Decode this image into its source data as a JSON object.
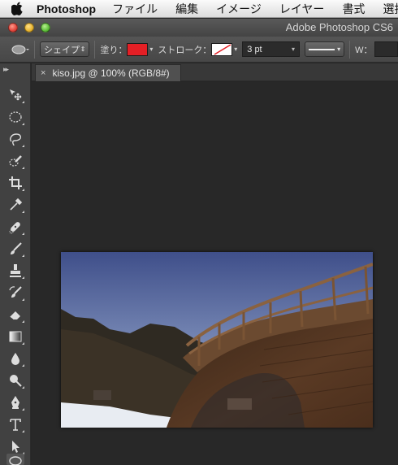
{
  "menubar": {
    "apple_icon": "apple-logo-icon",
    "app_name": "Photoshop",
    "items": [
      "ファイル",
      "編集",
      "イメージ",
      "レイヤー",
      "書式",
      "選択"
    ]
  },
  "window": {
    "title": "Adobe Photoshop CS6"
  },
  "options_bar": {
    "tool_icon": "ellipse-shape-icon",
    "mode_label": "シェイプ",
    "fill_label": "塗り：",
    "fill_color": "#e41f25",
    "stroke_label": "ストローク：",
    "stroke_color": "none",
    "stroke_width": "3 pt",
    "width_label": "W："
  },
  "tools": [
    "move-tool-icon",
    "ellipse-marquee-tool-icon",
    "lasso-tool-icon",
    "quick-selection-tool-icon",
    "crop-tool-icon",
    "eyedropper-tool-icon",
    "spot-healing-tool-icon",
    "brush-tool-icon",
    "clone-stamp-tool-icon",
    "history-brush-tool-icon",
    "eraser-tool-icon",
    "gradient-tool-icon",
    "blur-tool-icon",
    "dodge-tool-icon",
    "pen-tool-icon",
    "type-tool-icon",
    "path-selection-tool-icon",
    "ellipse-tool-icon"
  ],
  "document": {
    "tab_close": "×",
    "tab_title": "kiso.jpg @ 100% (RGB/8#)"
  },
  "colors": {
    "workspace": "#282828",
    "panel": "#414141",
    "fill_swatch": "#e41f25"
  }
}
